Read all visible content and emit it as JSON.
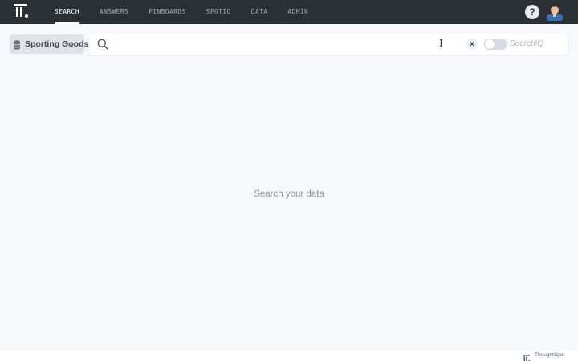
{
  "nav": {
    "items": [
      {
        "label": "SEARCH",
        "active": true
      },
      {
        "label": "ANSWERS",
        "active": false
      },
      {
        "label": "PINBOARDS",
        "active": false
      },
      {
        "label": "SPOTIQ",
        "active": false
      },
      {
        "label": "DATA",
        "active": false
      },
      {
        "label": "ADMIN",
        "active": false
      }
    ],
    "help_label": "?"
  },
  "search": {
    "data_source": "Sporting Goods",
    "value": "",
    "placeholder": "",
    "clear_label": "×",
    "searchiq_label": "SearchIQ",
    "searchiq_enabled": false
  },
  "main": {
    "empty_message": "Search your data"
  },
  "footer": {
    "brand": "ThoughtSpot"
  },
  "colors": {
    "topbar": "#2b3035",
    "background": "#f6f8fb",
    "active_nav": "#ffffff"
  },
  "icons": [
    "thoughtspot-logo-icon",
    "help-icon",
    "user-avatar",
    "database-icon",
    "search-icon",
    "text-cursor-icon",
    "clear-icon",
    "thoughtspot-footer-logo-icon"
  ]
}
